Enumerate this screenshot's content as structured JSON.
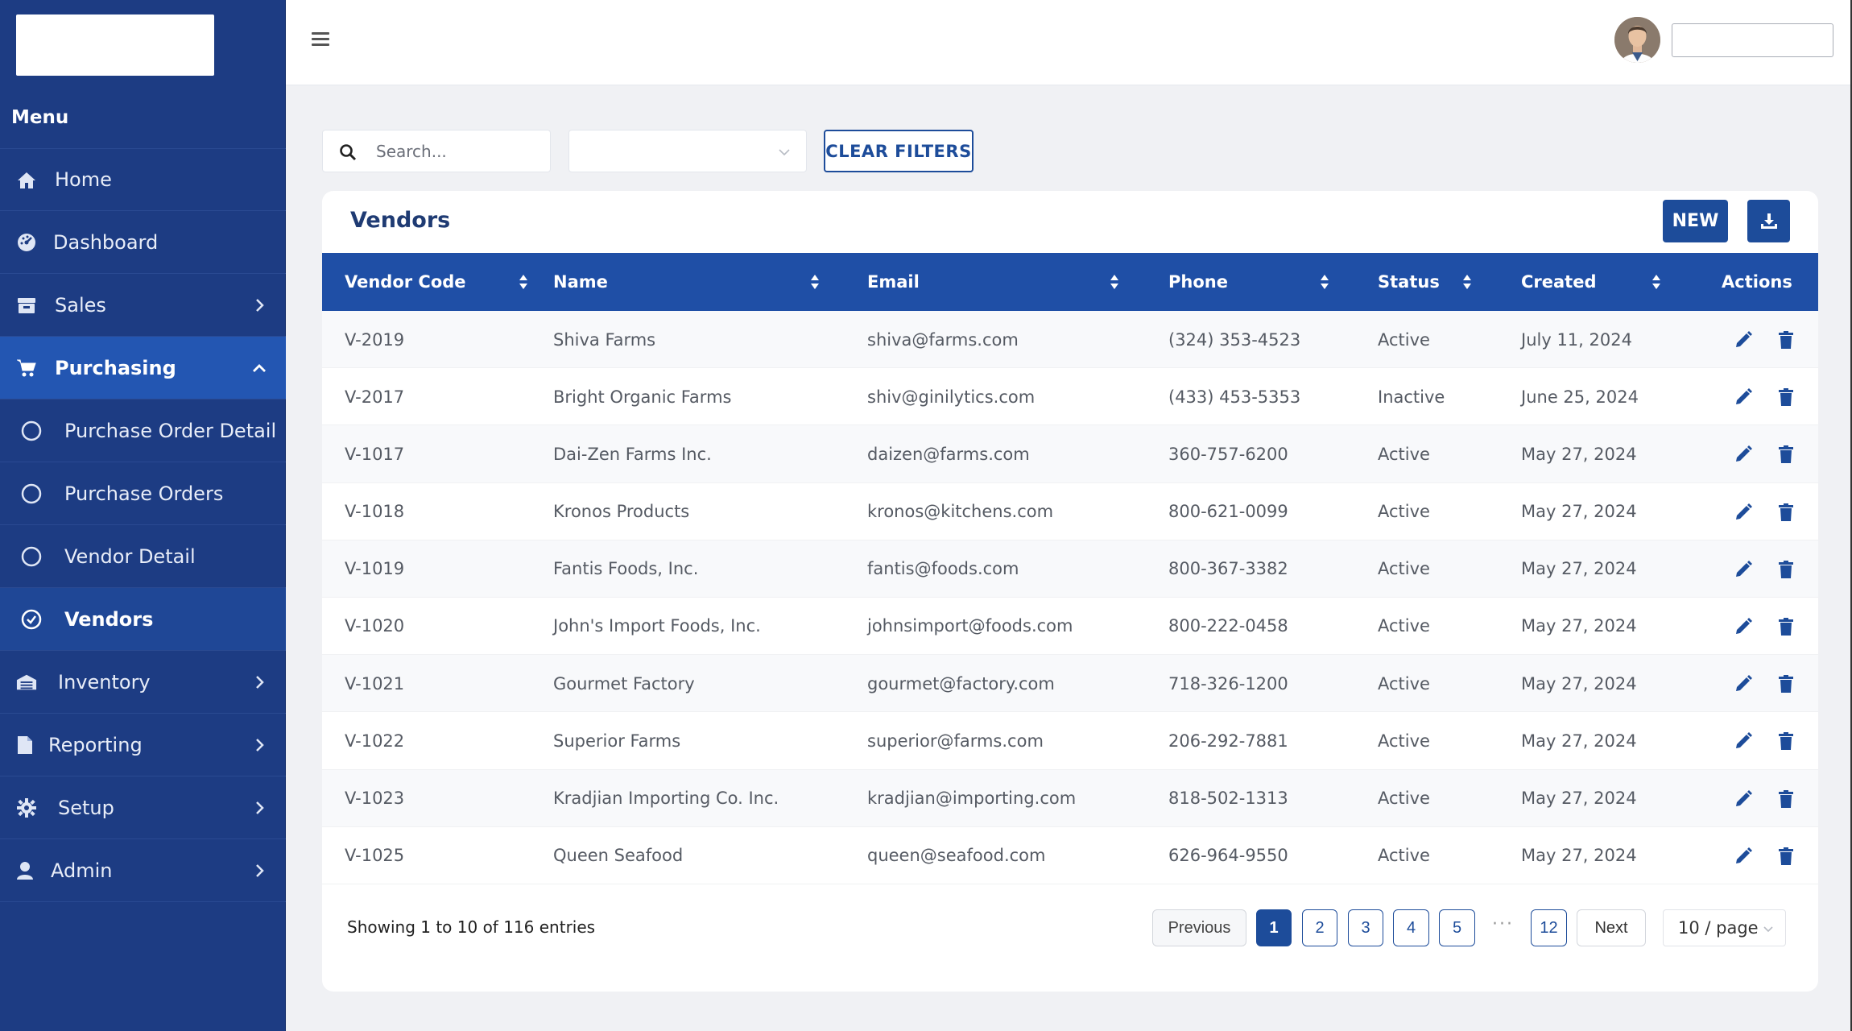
{
  "sidebar": {
    "menu_title": "Menu",
    "items": [
      {
        "label": "Home",
        "icon": "home-icon"
      },
      {
        "label": "Dashboard",
        "icon": "dashboard-icon"
      },
      {
        "label": "Sales",
        "icon": "sales-icon"
      },
      {
        "label": "Purchasing",
        "icon": "cart-icon"
      },
      {
        "label": "Purchase Order Detail",
        "icon": "circle-icon"
      },
      {
        "label": "Purchase Orders",
        "icon": "circle-icon"
      },
      {
        "label": "Vendor Detail",
        "icon": "circle-icon"
      },
      {
        "label": "Vendors",
        "icon": "check-circle-icon"
      },
      {
        "label": "Inventory",
        "icon": "inventory-icon"
      },
      {
        "label": "Reporting",
        "icon": "file-icon"
      },
      {
        "label": "Setup",
        "icon": "gear-icon"
      },
      {
        "label": "Admin",
        "icon": "user-icon"
      }
    ]
  },
  "filters": {
    "search_placeholder": "Search...",
    "clear_label": "CLEAR FILTERS"
  },
  "card": {
    "title": "Vendors",
    "new_label": "NEW"
  },
  "table": {
    "headers": [
      "Vendor Code",
      "Name",
      "Email",
      "Phone",
      "Status",
      "Created",
      "Actions"
    ],
    "rows": [
      [
        "V-2019",
        "Shiva Farms",
        "shiva@farms.com",
        "(324) 353-4523",
        "Active",
        "July 11, 2024"
      ],
      [
        "V-2017",
        "Bright Organic Farms",
        "shiv@ginilytics.com",
        "(433) 453-5353",
        "Inactive",
        "June 25, 2024"
      ],
      [
        "V-1017",
        "Dai-Zen Farms Inc.",
        "daizen@farms.com",
        "360-757-6200",
        "Active",
        "May 27, 2024"
      ],
      [
        "V-1018",
        "Kronos Products",
        "kronos@kitchens.com",
        "800-621-0099",
        "Active",
        "May 27, 2024"
      ],
      [
        "V-1019",
        "Fantis Foods, Inc.",
        "fantis@foods.com",
        "800-367-3382",
        "Active",
        "May 27, 2024"
      ],
      [
        "V-1020",
        "John's Import Foods, Inc.",
        "johnsimport@foods.com",
        "800-222-0458",
        "Active",
        "May 27, 2024"
      ],
      [
        "V-1021",
        "Gourmet Factory",
        "gourmet@factory.com",
        "718-326-1200",
        "Active",
        "May 27, 2024"
      ],
      [
        "V-1022",
        "Superior Farms",
        "superior@farms.com",
        "206-292-7881",
        "Active",
        "May 27, 2024"
      ],
      [
        "V-1023",
        "Kradjian Importing Co. Inc.",
        "kradjian@importing.com",
        "818-502-1313",
        "Active",
        "May 27, 2024"
      ],
      [
        "V-1025",
        "Queen Seafood",
        "queen@seafood.com",
        "626-964-9550",
        "Active",
        "May 27, 2024"
      ]
    ]
  },
  "pagination": {
    "showing": "Showing 1 to 10 of 116 entries",
    "previous": "Previous",
    "next": "Next",
    "pages": [
      "1",
      "2",
      "3",
      "4",
      "5",
      "12"
    ],
    "ellipsis": "···",
    "per_page": "10 / page"
  },
  "colors": {
    "sidebar": "#1d3c83",
    "accent": "#1d4c9a",
    "header": "#1f4fa6"
  }
}
